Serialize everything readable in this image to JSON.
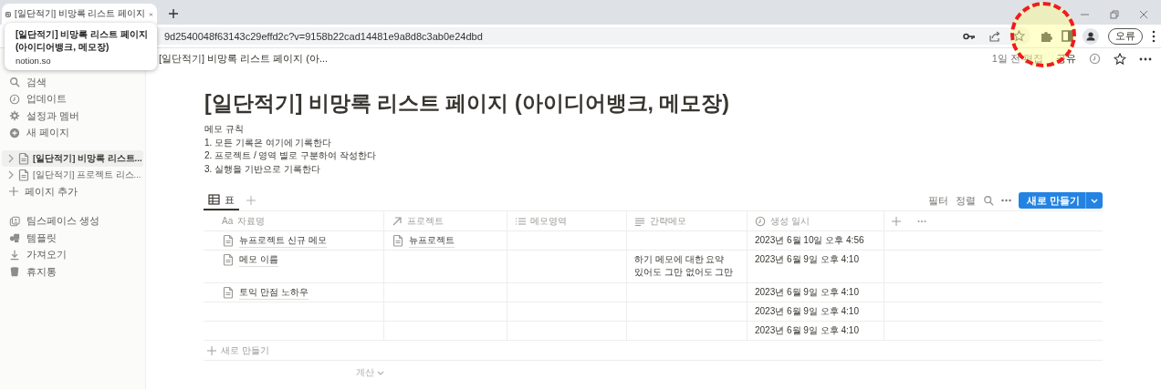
{
  "browser": {
    "tabs": [
      {
        "title": "[일단적기] 비망록 리스트 페이지",
        "selected": true
      }
    ],
    "url": "9d2540048f63143c29effd2c?v=9158b22cad14481e9a8d8c3ab0e24dbd",
    "profile_button": "오류"
  },
  "tooltip": {
    "title": "[일단적기] 비망록 리스트 페이지 (아이디어뱅크, 메모장)",
    "domain": "notion.so"
  },
  "topbar": {
    "breadcrumb": "[일단적기] 비망록 리스트 페이지 (아...",
    "edited": "1일 전 편집",
    "share": "공유"
  },
  "sidebar": {
    "items": [
      {
        "kind": "search",
        "label": "검색"
      },
      {
        "kind": "updates",
        "label": "업데이트"
      },
      {
        "kind": "settings",
        "label": "설정과 멤버"
      },
      {
        "kind": "new",
        "label": "새 페이지"
      }
    ],
    "pages": [
      {
        "label": "[일단적기] 비망록 리스트...",
        "selected": true
      },
      {
        "label": "[일단적기] 프로젝트 리스...",
        "selected": false
      }
    ],
    "add_page": "페이지 추가",
    "bottom_items": [
      {
        "kind": "teamspace",
        "label": "팀스페이스 생성"
      },
      {
        "kind": "templates",
        "label": "템플릿"
      },
      {
        "kind": "import",
        "label": "가져오기"
      },
      {
        "kind": "trash",
        "label": "휴지통"
      }
    ]
  },
  "page": {
    "title": "[일단적기] 비망록 리스트 페이지 (아이디어뱅크, 메모장)",
    "lines": [
      "메모 규칙",
      "1. 모든 기록은 여기에 기록한다",
      "2. 프로젝트 / 영역 별로 구분하여 작성한다",
      "3. 실행을 기반으로 기록한다"
    ]
  },
  "views": [
    {
      "label": "표",
      "selected": true
    }
  ],
  "toolbar": {
    "filter": "필터",
    "sort": "정렬",
    "new_button": "새로 만들기"
  },
  "table": {
    "columns": [
      {
        "kind": "title",
        "prefix": "Aa",
        "label": "자료명"
      },
      {
        "kind": "relation",
        "label": "프로젝트"
      },
      {
        "kind": "multi",
        "label": "메모영역"
      },
      {
        "kind": "text",
        "label": "간략메모"
      },
      {
        "kind": "created",
        "label": "생성 일시"
      }
    ],
    "rows": [
      {
        "name": "뉴프로젝트 신규 메모",
        "project": "뉴프로젝트",
        "created": "2023년 6월 10일 오후 4:56"
      },
      {
        "name": "메모 이름",
        "summary": "하기 메모에 대한 요약 있어도 그만 없어도 그만",
        "created": "2023년 6월 9일 오후 4:10"
      },
      {
        "name": "토익 만점 노하우",
        "created": "2023년 6월 9일 오후 4:10"
      },
      {
        "created": "2023년 6월 9일 오후 4:10"
      },
      {
        "created": "2023년 6월 9일 오후 4:10"
      }
    ],
    "add_row": "새로 만들기",
    "calculate": "계산"
  },
  "annotations": [
    {
      "kind": "dashed-circle"
    }
  ]
}
